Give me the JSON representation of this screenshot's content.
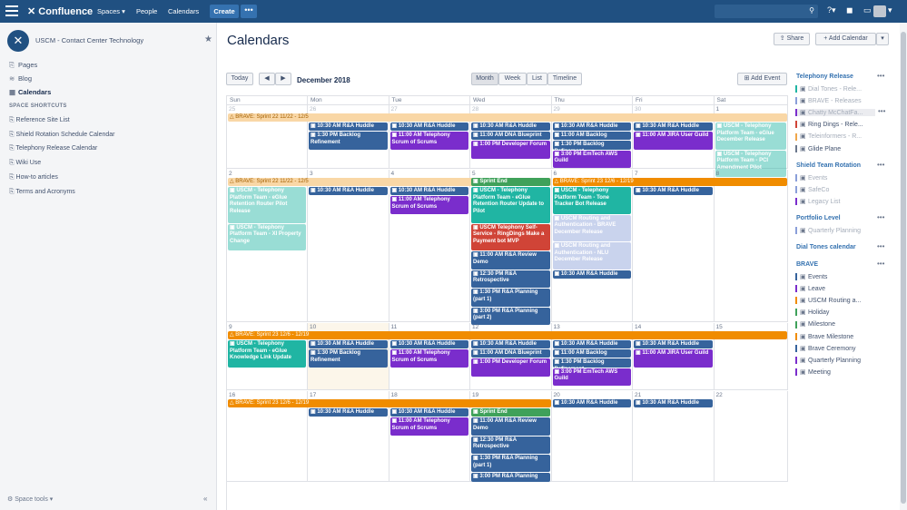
{
  "topbar": {
    "brand": "Confluence",
    "spaces": "Spaces ▾",
    "people": "People",
    "calendars": "Calendars",
    "create": "Create",
    "more": "•••"
  },
  "sidebar": {
    "space_name": "USCM - Contact Center Technology",
    "pages": "Pages",
    "blog": "Blog",
    "calendars": "Calendars",
    "shortcuts_header": "SPACE SHORTCUTS",
    "shortcuts": [
      "Reference Site List",
      "Shield Rotation Schedule Calendar",
      "Telephony Release Calendar",
      "Wiki Use",
      "How-to articles",
      "Terms and Acronyms"
    ],
    "space_tools": "Space tools ▾",
    "collapse": "«"
  },
  "main": {
    "title": "Calendars",
    "share": "Share",
    "add_calendar": "+ Add Calendar",
    "today": "Today",
    "month_title": "December 2018",
    "views": [
      "Month",
      "Week",
      "List",
      "Timeline"
    ],
    "add_event": "Add Event"
  },
  "weekdays": [
    "Sun",
    "Mon",
    "Tue",
    "Wed",
    "Thu",
    "Fri",
    "Sat"
  ],
  "weeks": [
    {
      "days": [
        "25",
        "26",
        "27",
        "28",
        "29",
        "30",
        "1"
      ],
      "other": [
        true,
        true,
        true,
        true,
        true,
        true,
        false
      ],
      "spans": [
        {
          "text": "BRAVE: Sprint 22 11/22 - 12/5",
          "col": 0,
          "len": 7,
          "color": "#f0a64a",
          "light": true
        }
      ],
      "events": [
        {
          "col": 1,
          "row": 0,
          "h": 1,
          "t": "10:30 AM R&A Huddle",
          "c": "#36639c"
        },
        {
          "col": 1,
          "row": 1,
          "h": 2,
          "t": "1:30 PM Backlog Refinement",
          "c": "#36639c"
        },
        {
          "col": 2,
          "row": 0,
          "h": 1,
          "t": "10:30 AM R&A Huddle",
          "c": "#36639c"
        },
        {
          "col": 2,
          "row": 1,
          "h": 2,
          "t": "11:00 AM Telephony Scrum of Scrums",
          "c": "#7a2dcc"
        },
        {
          "col": 3,
          "row": 0,
          "h": 1,
          "t": "10:30 AM R&A Huddle",
          "c": "#36639c"
        },
        {
          "col": 3,
          "row": 1,
          "h": 1,
          "t": "11:00 AM DNA Blueprint",
          "c": "#36639c"
        },
        {
          "col": 3,
          "row": 2,
          "h": 2,
          "t": "1:00 PM Developer Forum",
          "c": "#7a2dcc"
        },
        {
          "col": 4,
          "row": 0,
          "h": 1,
          "t": "10:30 AM R&A Huddle",
          "c": "#36639c"
        },
        {
          "col": 4,
          "row": 1,
          "h": 1,
          "t": "11:00 AM Backlog",
          "c": "#36639c"
        },
        {
          "col": 4,
          "row": 2,
          "h": 1,
          "t": "1:30 PM Backlog Refinement",
          "c": "#36639c"
        },
        {
          "col": 4,
          "row": 3,
          "h": 2,
          "t": "3:00 PM EmTech AWS Guild",
          "c": "#7a2dcc"
        },
        {
          "col": 5,
          "row": 0,
          "h": 1,
          "t": "10:30 AM R&A Huddle",
          "c": "#36639c"
        },
        {
          "col": 5,
          "row": 1,
          "h": 2,
          "t": "11:00 AM JIRA User Guild",
          "c": "#7a2dcc"
        },
        {
          "col": 6,
          "row": 0,
          "h": 3,
          "t": "USCM - Telephony Platform Team - eGlue December Release",
          "c": "#20b5a3",
          "faded": true
        },
        {
          "col": 6,
          "row": 3,
          "h": 3,
          "t": "USCM - Telephony Platform Team - PCI Amendment Pilot",
          "c": "#20b5a3",
          "faded": true
        }
      ],
      "height": 70
    },
    {
      "days": [
        "2",
        "3",
        "4",
        "5",
        "6",
        "7",
        "8"
      ],
      "other": [
        false,
        false,
        false,
        false,
        false,
        false,
        false
      ],
      "spans": [
        {
          "text": "BRAVE: Sprint 22 11/22 - 12/5",
          "col": 0,
          "len": 4,
          "color": "#f0a64a",
          "light": true
        },
        {
          "text": "BRAVE: Sprint 23 12/6 - 12/19",
          "col": 4,
          "len": 3,
          "color": "#f08c00",
          "light": false
        }
      ],
      "events": [
        {
          "col": 0,
          "row": 0,
          "h": 4,
          "t": "USCM - Telephony Platform Team - eGlue Retention Router Pilot Release",
          "c": "#20b5a3",
          "faded": true
        },
        {
          "col": 0,
          "row": 4,
          "h": 3,
          "t": "USCM - Telephony Platform Team - XI Property Change",
          "c": "#20b5a3",
          "faded": true
        },
        {
          "col": 1,
          "row": 0,
          "h": 1,
          "t": "10:30 AM R&A Huddle",
          "c": "#36639c"
        },
        {
          "col": 2,
          "row": 0,
          "h": 1,
          "t": "10:30 AM R&A Huddle",
          "c": "#36639c"
        },
        {
          "col": 2,
          "row": 1,
          "h": 2,
          "t": "11:00 AM Telephony Scrum of Scrums",
          "c": "#7a2dcc"
        },
        {
          "col": 3,
          "row": -1,
          "h": 1,
          "t": "Sprint End",
          "c": "#3fa15a"
        },
        {
          "col": 3,
          "row": 0,
          "h": 4,
          "t": "USCM - Telephony Platform Team - eGlue Retention Router Update to Pilot",
          "c": "#20b5a3"
        },
        {
          "col": 3,
          "row": 4,
          "h": 3,
          "t": "USCM Telephony Self-Service - RingDings Make a Payment bot MVP",
          "c": "#d04437"
        },
        {
          "col": 3,
          "row": 7,
          "h": 2,
          "t": "11:00 AM R&A Review Demo",
          "c": "#36639c"
        },
        {
          "col": 3,
          "row": 9,
          "h": 2,
          "t": "12:30 PM R&A Retrospective",
          "c": "#36639c"
        },
        {
          "col": 3,
          "row": 11,
          "h": 2,
          "t": "1:30 PM R&A Planning (part 1)",
          "c": "#36639c"
        },
        {
          "col": 3,
          "row": 13,
          "h": 2,
          "t": "3:00 PM R&A Planning (part 2)",
          "c": "#36639c"
        },
        {
          "col": 4,
          "row": 0,
          "h": 3,
          "t": "USCM - Telephony Platform Team - Tone Tracker Bot Release",
          "c": "#20b5a3"
        },
        {
          "col": 4,
          "row": 3,
          "h": 3,
          "t": "USCM Routing and Authentication - BRAVE December Release",
          "c": "#8a9ed9",
          "faded": true
        },
        {
          "col": 4,
          "row": 6,
          "h": 3,
          "t": "USCM Routing and Authentication - NLU December Release",
          "c": "#8a9ed9",
          "faded": true
        },
        {
          "col": 4,
          "row": 9,
          "h": 1,
          "t": "10:30 AM R&A Huddle",
          "c": "#36639c"
        },
        {
          "col": 5,
          "row": 0,
          "h": 1,
          "t": "10:30 AM R&A Huddle",
          "c": "#36639c"
        }
      ],
      "height": 168
    },
    {
      "days": [
        "9",
        "10",
        "11",
        "12",
        "13",
        "14",
        "15"
      ],
      "other": [
        false,
        false,
        false,
        false,
        false,
        false,
        false
      ],
      "spans": [
        {
          "text": "BRAVE: Sprint 23 12/6 - 12/19",
          "col": 0,
          "len": 7,
          "color": "#f08c00",
          "light": false
        }
      ],
      "events": [
        {
          "col": 0,
          "row": 0,
          "h": 3,
          "t": "USCM - Telephony Platform Team - eGlue Knowledge Link Update",
          "c": "#20b5a3"
        },
        {
          "col": 1,
          "row": 0,
          "h": 1,
          "t": "10:30 AM R&A Huddle",
          "c": "#36639c"
        },
        {
          "col": 1,
          "row": 1,
          "h": 2,
          "t": "1:30 PM Backlog Refinement",
          "c": "#36639c"
        },
        {
          "col": 2,
          "row": 0,
          "h": 1,
          "t": "10:30 AM R&A Huddle",
          "c": "#36639c"
        },
        {
          "col": 2,
          "row": 1,
          "h": 2,
          "t": "11:00 AM Telephony Scrum of Scrums",
          "c": "#7a2dcc"
        },
        {
          "col": 3,
          "row": 0,
          "h": 1,
          "t": "10:30 AM R&A Huddle",
          "c": "#36639c"
        },
        {
          "col": 3,
          "row": 1,
          "h": 1,
          "t": "11:00 AM DNA Blueprint",
          "c": "#36639c"
        },
        {
          "col": 3,
          "row": 2,
          "h": 2,
          "t": "1:00 PM Developer Forum",
          "c": "#7a2dcc"
        },
        {
          "col": 4,
          "row": 0,
          "h": 1,
          "t": "10:30 AM R&A Huddle",
          "c": "#36639c"
        },
        {
          "col": 4,
          "row": 1,
          "h": 1,
          "t": "11:00 AM Backlog",
          "c": "#36639c"
        },
        {
          "col": 4,
          "row": 2,
          "h": 1,
          "t": "1:30 PM Backlog Refinement",
          "c": "#36639c"
        },
        {
          "col": 4,
          "row": 3,
          "h": 2,
          "t": "3:00 PM EmTech AWS Guild",
          "c": "#7a2dcc"
        },
        {
          "col": 5,
          "row": 0,
          "h": 1,
          "t": "10:30 AM R&A Huddle",
          "c": "#36639c"
        },
        {
          "col": 5,
          "row": 1,
          "h": 2,
          "t": "11:00 AM JIRA User Guild",
          "c": "#7a2dcc"
        }
      ],
      "height": 74
    },
    {
      "days": [
        "16",
        "17",
        "18",
        "19",
        "20",
        "21",
        "22"
      ],
      "other": [
        false,
        false,
        false,
        false,
        false,
        false,
        false
      ],
      "spans": [
        {
          "text": "BRAVE: Sprint 23 12/6 - 12/19",
          "col": 0,
          "len": 4,
          "color": "#f08c00",
          "light": false
        }
      ],
      "events": [
        {
          "col": 1,
          "row": 0,
          "h": 1,
          "t": "10:30 AM R&A Huddle",
          "c": "#36639c"
        },
        {
          "col": 2,
          "row": 0,
          "h": 1,
          "t": "10:30 AM R&A Huddle",
          "c": "#36639c"
        },
        {
          "col": 2,
          "row": 1,
          "h": 2,
          "t": "11:00 AM Telephony Scrum of Scrums",
          "c": "#7a2dcc"
        },
        {
          "col": 3,
          "row": 0,
          "h": 1,
          "t": "Sprint End",
          "c": "#3fa15a"
        },
        {
          "col": 3,
          "row": 1,
          "h": 2,
          "t": "11:00 AM R&A Review Demo",
          "c": "#36639c"
        },
        {
          "col": 3,
          "row": 3,
          "h": 2,
          "t": "12:30 PM R&A Retrospective",
          "c": "#36639c"
        },
        {
          "col": 3,
          "row": 5,
          "h": 2,
          "t": "1:30 PM R&A Planning (part 1)",
          "c": "#36639c"
        },
        {
          "col": 3,
          "row": 7,
          "h": 1,
          "t": "3:00 PM R&A Planning",
          "c": "#36639c"
        },
        {
          "col": 4,
          "row": -1,
          "h": 1,
          "t": "10:30 AM R&A Huddle",
          "c": "#36639c"
        },
        {
          "col": 5,
          "row": -1,
          "h": 1,
          "t": "10:30 AM R&A Huddle",
          "c": "#36639c"
        }
      ],
      "height": 100
    }
  ],
  "right_panel": [
    {
      "head": "Telephony Release",
      "items": [
        {
          "t": "Dial Tones - Rele...",
          "c": "#20b5a3",
          "dim": true
        },
        {
          "t": "BRAVE - Releases",
          "c": "#8a9ed9",
          "dim": true
        },
        {
          "t": "Chatty McChatFa...",
          "c": "#7a2dcc",
          "dim": true,
          "hl": true
        },
        {
          "t": "Ring Dings - Rele...",
          "c": "#d04437",
          "dim": false
        },
        {
          "t": "Teleinformers - R...",
          "c": "#f0a64a",
          "dim": true
        },
        {
          "t": "Glide Plane",
          "c": "#6b778c",
          "dim": false
        }
      ]
    },
    {
      "head": "Shield Team Rotation",
      "items": [
        {
          "t": "Events",
          "c": "#8a9ed9",
          "dim": true
        },
        {
          "t": "SafeCo",
          "c": "#8a9ed9",
          "dim": true
        },
        {
          "t": "Legacy List",
          "c": "#7a2dcc",
          "dim": true
        }
      ]
    },
    {
      "head": "Portfolio Level",
      "items": [
        {
          "t": "Quarterly Planning",
          "c": "#8a9ed9",
          "dim": true
        }
      ]
    },
    {
      "head": "Dial Tones calendar",
      "items": []
    },
    {
      "head": "BRAVE",
      "items": [
        {
          "t": "Events",
          "c": "#36639c",
          "dim": false
        },
        {
          "t": "Leave",
          "c": "#7a2dcc",
          "dim": false
        },
        {
          "t": "USCM Routing a...",
          "c": "#f08c00",
          "dim": false
        },
        {
          "t": "Holiday",
          "c": "#3fa15a",
          "dim": false
        },
        {
          "t": "Milestone",
          "c": "#3fa15a",
          "dim": false
        },
        {
          "t": "Brave Milestone",
          "c": "#f08c00",
          "dim": false
        },
        {
          "t": "Brave Ceremony",
          "c": "#36639c",
          "dim": false
        },
        {
          "t": "Quarterly Planning",
          "c": "#7a2dcc",
          "dim": false
        },
        {
          "t": "Meeting",
          "c": "#7a2dcc",
          "dim": false
        }
      ]
    }
  ]
}
